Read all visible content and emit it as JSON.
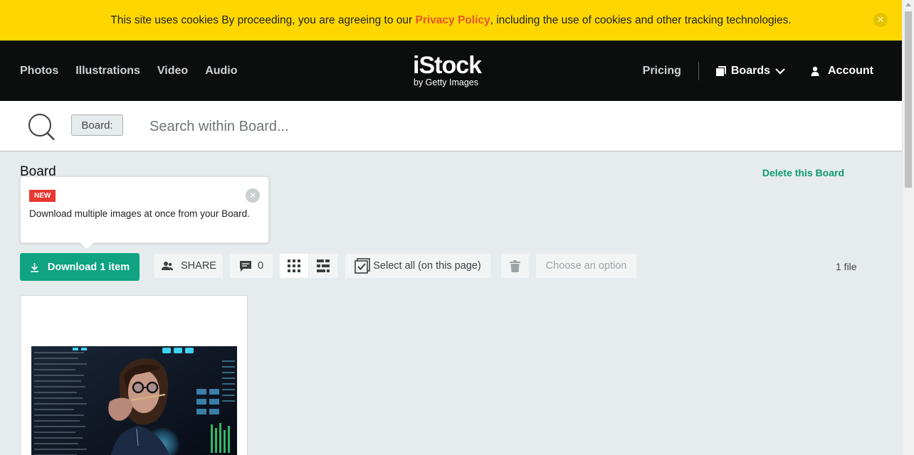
{
  "cookie": {
    "text_before": "This site uses cookies By proceeding, you are agreeing to our ",
    "policy_link": "Privacy Policy",
    "text_after": ", including the use of cookies and other tracking technologies.",
    "close_icon": "close-icon"
  },
  "nav": {
    "left": [
      "Photos",
      "Illustrations",
      "Video",
      "Audio"
    ],
    "logo_main": "iStock",
    "logo_sub": "by Getty Images",
    "pricing": "Pricing",
    "boards": "Boards",
    "account": "Account"
  },
  "search": {
    "chip": "Board:",
    "placeholder": "Search within Board..."
  },
  "board": {
    "title": "Board",
    "delete": "Delete this Board"
  },
  "tooltip": {
    "badge": "NEW",
    "text": "Download multiple images at once from your Board."
  },
  "toolbar": {
    "download": "Download 1 item",
    "share": "SHARE",
    "comments": "0",
    "select_all": "Select all (on this page)",
    "choose_option": "Choose an option",
    "file_count": "1 file"
  },
  "colors": {
    "cookie_bg": "#ffd700",
    "nav_bg": "#0c0d0d",
    "accent": "#0fa382",
    "policy": "#e8542a",
    "new_badge": "#e8382f"
  }
}
